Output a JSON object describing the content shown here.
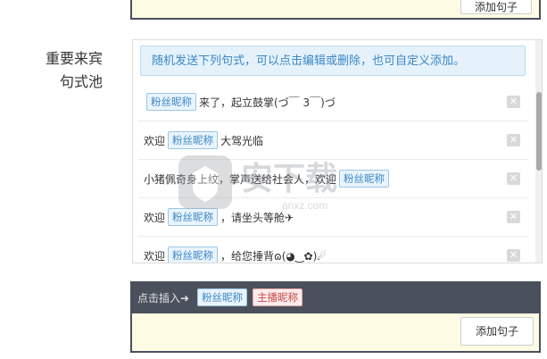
{
  "top_editor": {
    "add_button_label": "添加句子"
  },
  "section": {
    "label_line1": "重要来宾",
    "label_line2": "句式池"
  },
  "notice": "随机发送下列句式，可以点击编辑或删除，也可自定义添加。",
  "rows": [
    {
      "parts": [
        {
          "type": "tag",
          "text": "粉丝昵称"
        },
        {
          "type": "text",
          "text": "来了，起立鼓掌(づ￣ 3￣)づ"
        }
      ]
    },
    {
      "parts": [
        {
          "type": "text",
          "text": "欢迎"
        },
        {
          "type": "tag",
          "text": "粉丝昵称"
        },
        {
          "type": "text",
          "text": "大驾光临"
        }
      ]
    },
    {
      "parts": [
        {
          "type": "text",
          "text": "小猪佩奇身上纹，掌声送给社会人，欢迎"
        },
        {
          "type": "tag",
          "text": "粉丝昵称"
        }
      ]
    },
    {
      "parts": [
        {
          "type": "text",
          "text": "欢迎"
        },
        {
          "type": "tag",
          "text": "粉丝昵称"
        },
        {
          "type": "text",
          "text": "，请坐头等舱✈"
        }
      ]
    },
    {
      "parts": [
        {
          "type": "text",
          "text": "欢迎"
        },
        {
          "type": "tag",
          "text": "粉丝昵称"
        },
        {
          "type": "text",
          "text": "，给您捶背ɷ(◕‿✿)☄"
        }
      ]
    }
  ],
  "delete_icon": "close-icon",
  "insert_bar": {
    "label": "点击插入➜",
    "tags": [
      {
        "text": "粉丝昵称",
        "kind": "fan"
      },
      {
        "text": "主播昵称",
        "kind": "host"
      }
    ]
  },
  "editor": {
    "add_button_label": "添加句子",
    "value": ""
  },
  "watermark": {
    "text": "安下载",
    "subtext": "anxz.com"
  },
  "colors": {
    "accent": "#3a87c8",
    "toolbar": "#4b515c",
    "editor_bg": "#fdfbe3",
    "host_tag": "#c9484a"
  }
}
